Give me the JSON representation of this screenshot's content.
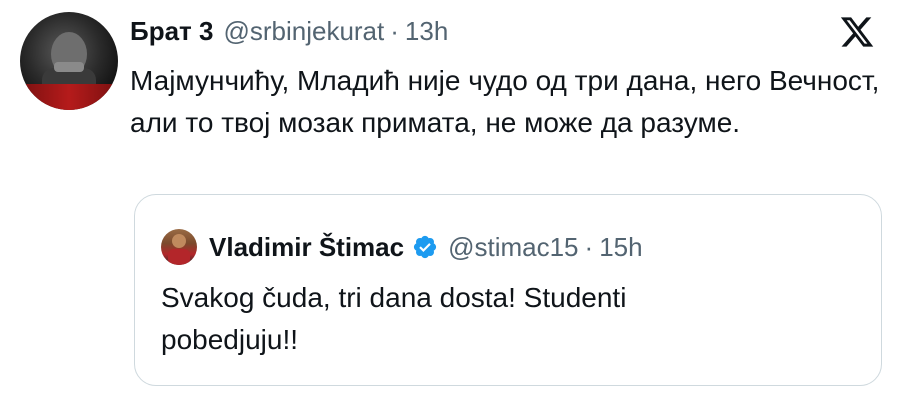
{
  "tweet": {
    "author_name": "Брат 3",
    "handle": "@srbinjekurat",
    "separator": "·",
    "time": "13h",
    "text": "Мајмунчићу, Младић није чудо од три дана, него Вечност, али то твој мозак примата, не може да разуме.",
    "avatar_icon": "user-avatar-image",
    "platform_icon": "x-logo-icon"
  },
  "quoted_tweet": {
    "author_name": "Vladimir Štimac",
    "handle": "@stimac15",
    "separator": "·",
    "time": "15h",
    "text": "Svakog čuda, tri dana dosta! Studenti pobedjuju!!",
    "verified_icon": "verified-badge-icon",
    "verified_color": "#1d9bf0"
  },
  "colors": {
    "text": "#0f1419",
    "secondary": "#536471",
    "border": "#cfd9de"
  }
}
